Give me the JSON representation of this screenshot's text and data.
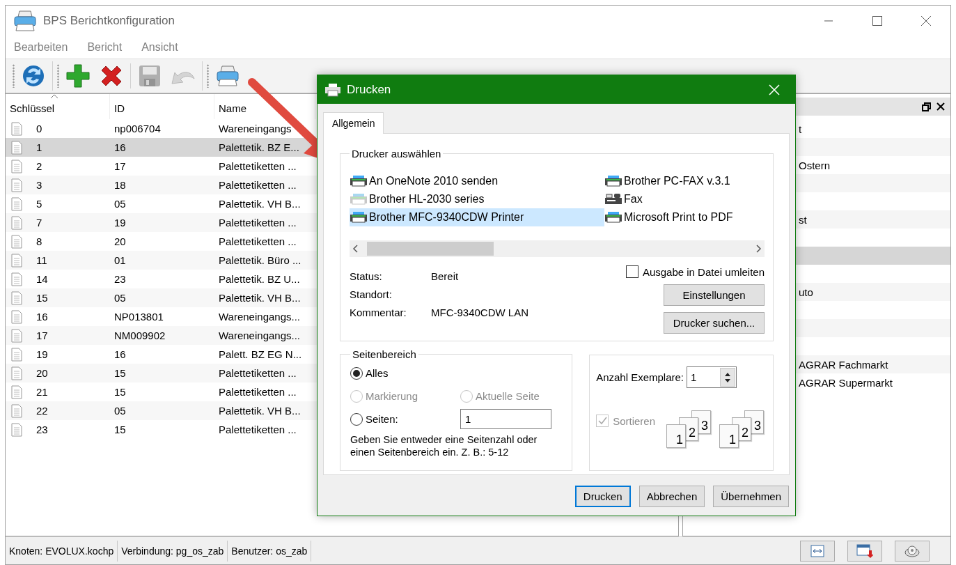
{
  "window": {
    "title": "BPS Berichtkonfiguration"
  },
  "menu": [
    "Bearbeiten",
    "Bericht",
    "Ansicht"
  ],
  "toolbar": [
    {
      "items": [
        {
          "kind": "refresh",
          "disabled": false
        }
      ]
    },
    {
      "items": [
        {
          "kind": "add",
          "disabled": false
        },
        {
          "kind": "delete",
          "disabled": false
        },
        {
          "kind": "separator"
        },
        {
          "kind": "save",
          "disabled": true
        },
        {
          "kind": "undo",
          "disabled": true
        }
      ]
    },
    {
      "items": [
        {
          "kind": "print",
          "disabled": false
        }
      ]
    }
  ],
  "list": {
    "columns": [
      {
        "label": "Schlüssel",
        "sorted": true
      },
      {
        "label": "ID",
        "sorted": false
      },
      {
        "label": "Name",
        "sorted": false
      }
    ],
    "rows": [
      {
        "key": "0",
        "id": "np006704",
        "name": "Wareneingangs",
        "selected": false
      },
      {
        "key": "1",
        "id": "16",
        "name": "Palettetik. BZ E...",
        "selected": true
      },
      {
        "key": "2",
        "id": "17",
        "name": "Palettetiketten ...",
        "selected": false
      },
      {
        "key": "3",
        "id": "18",
        "name": "Palettetiketten ...",
        "selected": false
      },
      {
        "key": "5",
        "id": "05",
        "name": "Palettetik. VH B...",
        "selected": false
      },
      {
        "key": "7",
        "id": "19",
        "name": "Palettetiketten ...",
        "selected": false
      },
      {
        "key": "8",
        "id": "20",
        "name": "Palettetiketten ...",
        "selected": false
      },
      {
        "key": "11",
        "id": "01",
        "name": "Palettetik. Büro ...",
        "selected": false
      },
      {
        "key": "14",
        "id": "23",
        "name": "Palettetik. BZ U...",
        "selected": false
      },
      {
        "key": "15",
        "id": "05",
        "name": "Palettetik. VH B...",
        "selected": false
      },
      {
        "key": "16",
        "id": "NP013801",
        "name": "Wareneingangs...",
        "selected": false
      },
      {
        "key": "17",
        "id": "NM009902",
        "name": "Wareneingangs...",
        "selected": false
      },
      {
        "key": "19",
        "id": "16",
        "name": "Palett. BZ EG N...",
        "selected": false
      },
      {
        "key": "20",
        "id": "15",
        "name": "Palettetiketten ...",
        "selected": false
      },
      {
        "key": "21",
        "id": "15",
        "name": "Palettetiketten ...",
        "selected": false
      },
      {
        "key": "22",
        "id": "05",
        "name": "Palettetik. VH B...",
        "selected": false
      },
      {
        "key": "23",
        "id": "15",
        "name": "Palettetiketten ...",
        "selected": false
      }
    ]
  },
  "side_panel": {
    "rows": [
      {
        "text": "t",
        "selected": false
      },
      {
        "selected": false
      },
      {
        "text": "Ostern",
        "selected": false
      },
      {
        "selected": false
      },
      {
        "selected": false
      },
      {
        "text": "st",
        "selected": false
      },
      {
        "selected": false
      },
      {
        "selected": true
      },
      {
        "selected": false
      },
      {
        "text": "uto",
        "selected": false
      },
      {
        "selected": false
      },
      {
        "selected": false
      },
      {
        "selected": false
      },
      {
        "text": "AGRAR Fachmarkt",
        "selected": false
      },
      {
        "text": "AGRAR Supermarkt",
        "selected": false
      }
    ]
  },
  "status_bar": {
    "items": [
      "Knoten: EVOLUX.kochp",
      "Verbindung: pg_os_zab",
      "Benutzer: os_zab"
    ],
    "buttons": [
      {
        "kind": "fit-width"
      },
      {
        "kind": "export"
      },
      {
        "kind": "print-preview"
      }
    ]
  },
  "dialog": {
    "title": "Drucken",
    "tabs": [
      {
        "label": "Allgemein",
        "selected": true
      }
    ],
    "printer_group": {
      "legend": "Drucker auswählen",
      "printers": [
        {
          "name": "An OneNote 2010 senden",
          "kind": "printer",
          "offline": false,
          "selected": false
        },
        {
          "name": "Brother PC-FAX v.3.1",
          "kind": "printer",
          "offline": false,
          "selected": false
        },
        {
          "name": "Brother HL-2030 series",
          "kind": "printer",
          "offline": true,
          "selected": false
        },
        {
          "name": "Fax",
          "kind": "fax",
          "offline": false,
          "selected": false
        },
        {
          "name": "Brother MFC-9340CDW Printer",
          "kind": "printer",
          "offline": false,
          "selected": true
        },
        {
          "name": "Microsoft Print to PDF",
          "kind": "printer",
          "offline": false,
          "selected": false
        }
      ],
      "details": [
        {
          "label": "Status:",
          "value": "Bereit"
        },
        {
          "label": "Standort:"
        },
        {
          "label": "Kommentar:",
          "value": "MFC-9340CDW LAN"
        }
      ],
      "print_to_file": {
        "label": "Ausgabe in Datei umleiten",
        "checked": false
      },
      "buttons": [
        "Einstellungen",
        "Drucker suchen..."
      ]
    },
    "page_range": {
      "legend": "Seitenbereich",
      "options": [
        {
          "label": "Alles",
          "selected": true,
          "disabled": false
        },
        {
          "label": "Markierung",
          "selected": false,
          "disabled": true
        },
        {
          "label": "Aktuelle Seite",
          "selected": false,
          "disabled": true
        },
        {
          "label": "Seiten:",
          "selected": false,
          "disabled": false
        }
      ],
      "pages_value": "1",
      "hint": "Geben Sie entweder eine Seitenzahl oder einen Seitenbereich ein. Z. B.: 5-12"
    },
    "copies": {
      "label": "Anzahl Exemplare:",
      "value": "1",
      "collate": {
        "label": "Sortieren",
        "checked": true,
        "disabled": true
      },
      "collate_icons": [
        [
          "1",
          "2",
          "3"
        ],
        [
          "1",
          "2",
          "3"
        ]
      ]
    },
    "buttons": [
      {
        "label": "Drucken",
        "default": true
      },
      {
        "label": "Abbrechen",
        "default": false
      },
      {
        "label": "Übernehmen",
        "default": false
      }
    ]
  }
}
